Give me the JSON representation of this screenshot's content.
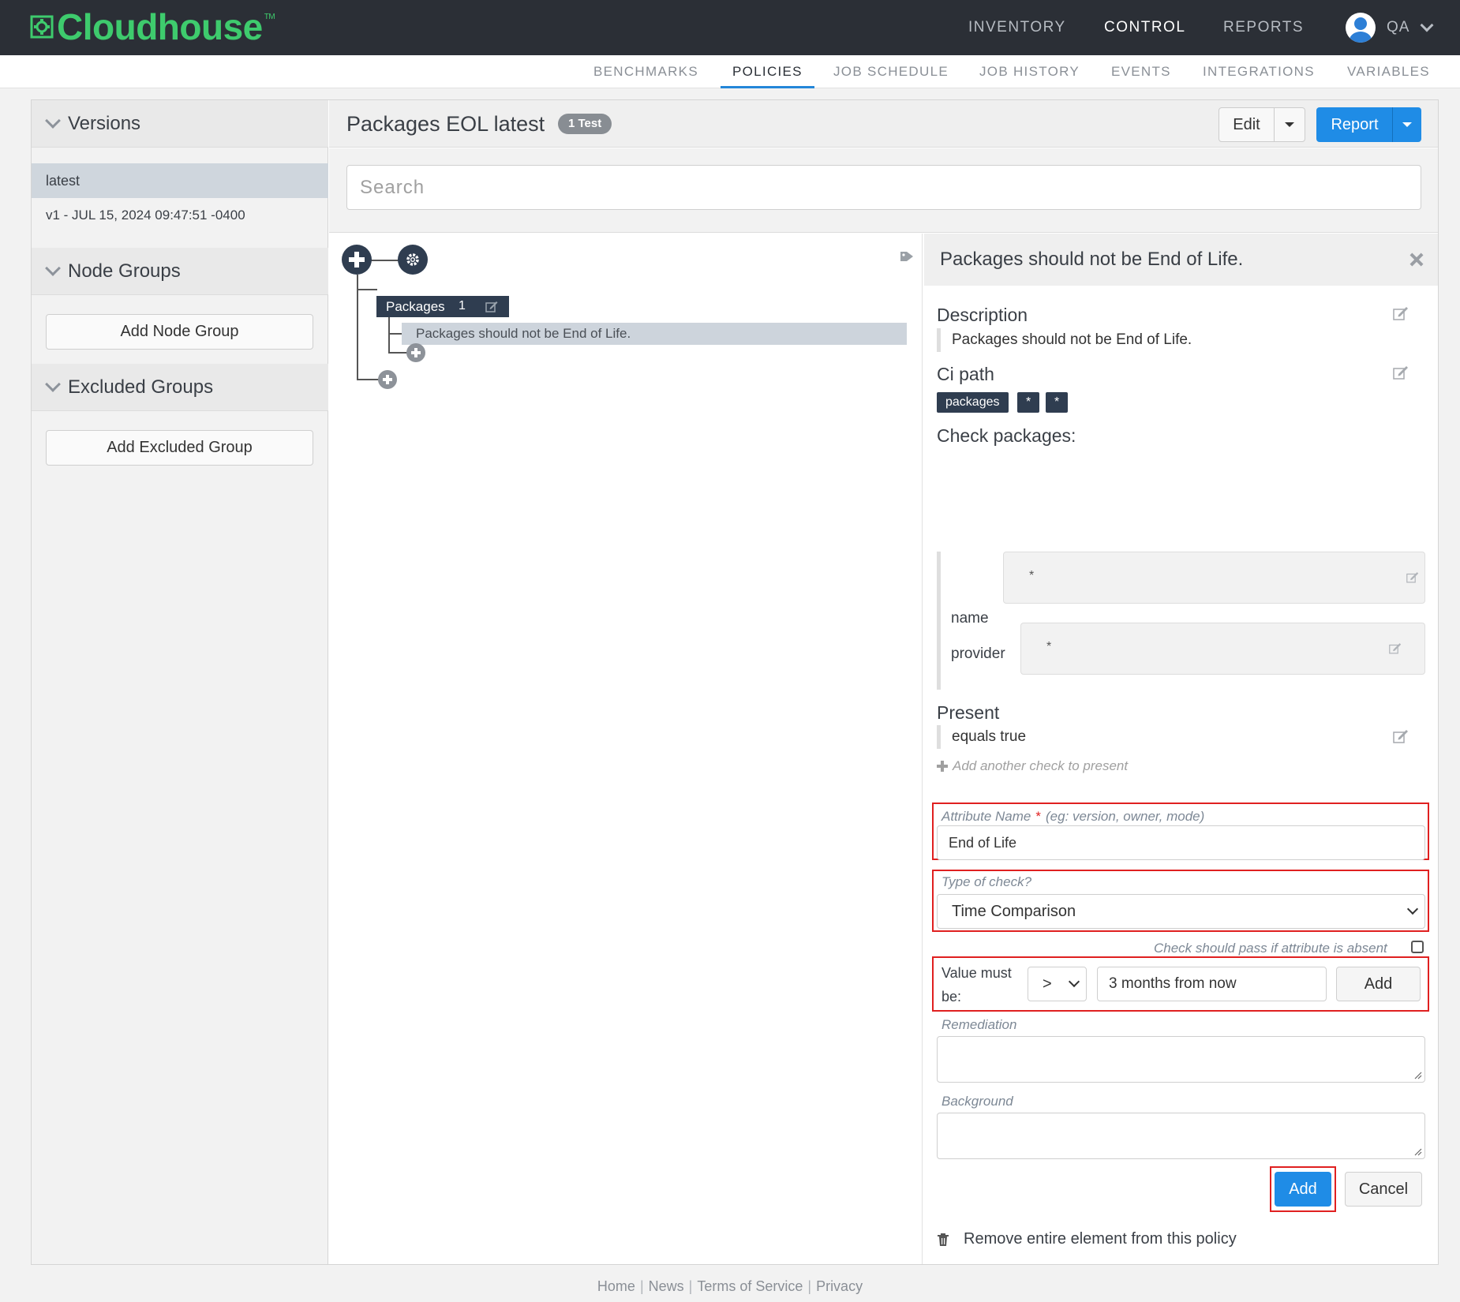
{
  "brand": {
    "name": "Cloudhouse",
    "tm": "TM",
    "color": "#3ecb6d"
  },
  "topnav": {
    "items": [
      {
        "label": "INVENTORY"
      },
      {
        "label": "CONTROL",
        "active": true
      },
      {
        "label": "REPORTS"
      }
    ],
    "user": {
      "label": "QA",
      "icon": "user-avatar-icon"
    }
  },
  "subnav": {
    "items": [
      {
        "label": "BENCHMARKS"
      },
      {
        "label": "POLICIES",
        "active": true
      },
      {
        "label": "JOB SCHEDULE"
      },
      {
        "label": "JOB HISTORY"
      },
      {
        "label": "EVENTS"
      },
      {
        "label": "INTEGRATIONS"
      },
      {
        "label": "VARIABLES"
      }
    ]
  },
  "sidebar": {
    "versions": {
      "title": "Versions",
      "items": [
        {
          "label": "latest",
          "selected": true
        },
        {
          "label": "v1 - JUL 15, 2024 09:47:51 -0400"
        }
      ]
    },
    "node_groups": {
      "title": "Node Groups",
      "button": "Add Node Group"
    },
    "excluded_groups": {
      "title": "Excluded Groups",
      "button": "Add Excluded Group"
    }
  },
  "policy": {
    "title": "Packages EOL latest",
    "badge": "1 Test",
    "edit_label": "Edit",
    "report_label": "Report",
    "search_placeholder": "Search"
  },
  "tree": {
    "group": {
      "label": "Packages",
      "count": "1"
    },
    "rule": "Packages should not be End of Life."
  },
  "detail": {
    "title": "Packages should not be End of Life.",
    "description_title": "Description",
    "description": "Packages should not be End of Life.",
    "ci_path_title": "Ci path",
    "ci_path": [
      "packages",
      "*",
      "*"
    ],
    "check_title": "Check packages:",
    "checks": [
      {
        "key": "name",
        "value": "*"
      },
      {
        "key": "provider",
        "value": "*"
      }
    ],
    "present_title": "Present",
    "present_value": "equals true",
    "add_another": "Add another check to present",
    "form": {
      "attribute_label": "Attribute Name",
      "attribute_required": "*",
      "attribute_hint": "(eg: version, owner, mode)",
      "attribute_value": "End of Life",
      "type_label": "Type of check?",
      "type_value": "Time Comparison",
      "absent_label": "Check should pass if attribute is absent",
      "value_label": "Value must be:",
      "operator": ">",
      "value": "3 months from now",
      "value_add": "Add",
      "remediation_label": "Remediation",
      "background_label": "Background",
      "add_button": "Add",
      "cancel_button": "Cancel"
    },
    "remove_label": "Remove entire element from this policy"
  },
  "footer": {
    "links": [
      "Home",
      "News",
      "Terms of Service",
      "Privacy"
    ]
  },
  "colors": {
    "accent": "#1f8ce6",
    "highlight": "#e02020",
    "nav_bg": "#2b2f36",
    "node_bg": "#2f3d50"
  }
}
